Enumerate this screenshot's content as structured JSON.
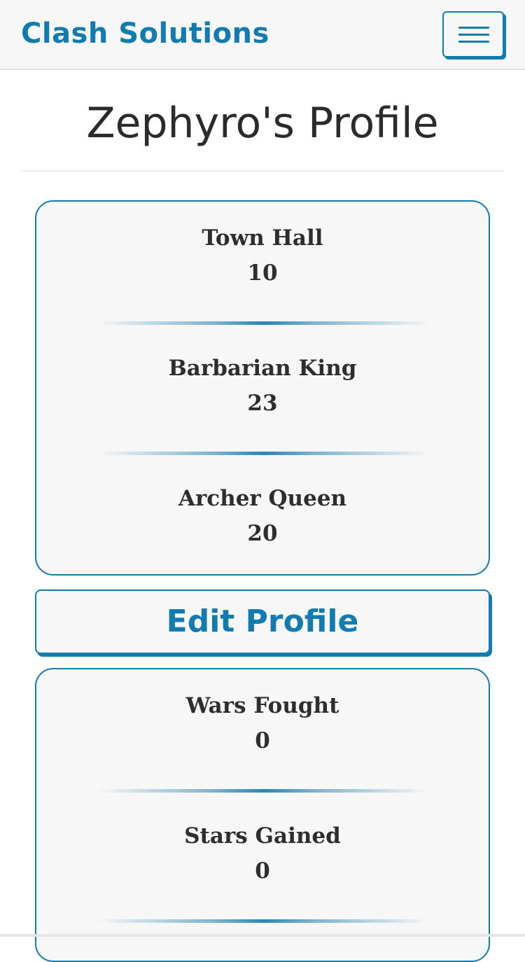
{
  "navbar": {
    "brand": "Clash Solutions",
    "menu_icon": "hamburger-menu-icon"
  },
  "page": {
    "title": "Zephyro's Profile"
  },
  "profile_stats": [
    {
      "label": "Town Hall",
      "value": "10"
    },
    {
      "label": "Barbarian King",
      "value": "23"
    },
    {
      "label": "Archer Queen",
      "value": "20"
    }
  ],
  "edit_button": {
    "label": "Edit Profile"
  },
  "war_stats": [
    {
      "label": "Wars Fought",
      "value": "0"
    },
    {
      "label": "Stars Gained",
      "value": "0"
    }
  ],
  "colors": {
    "accent": "#127bb0",
    "card_bg": "#f7f7f7",
    "text": "#2e2e2e"
  }
}
